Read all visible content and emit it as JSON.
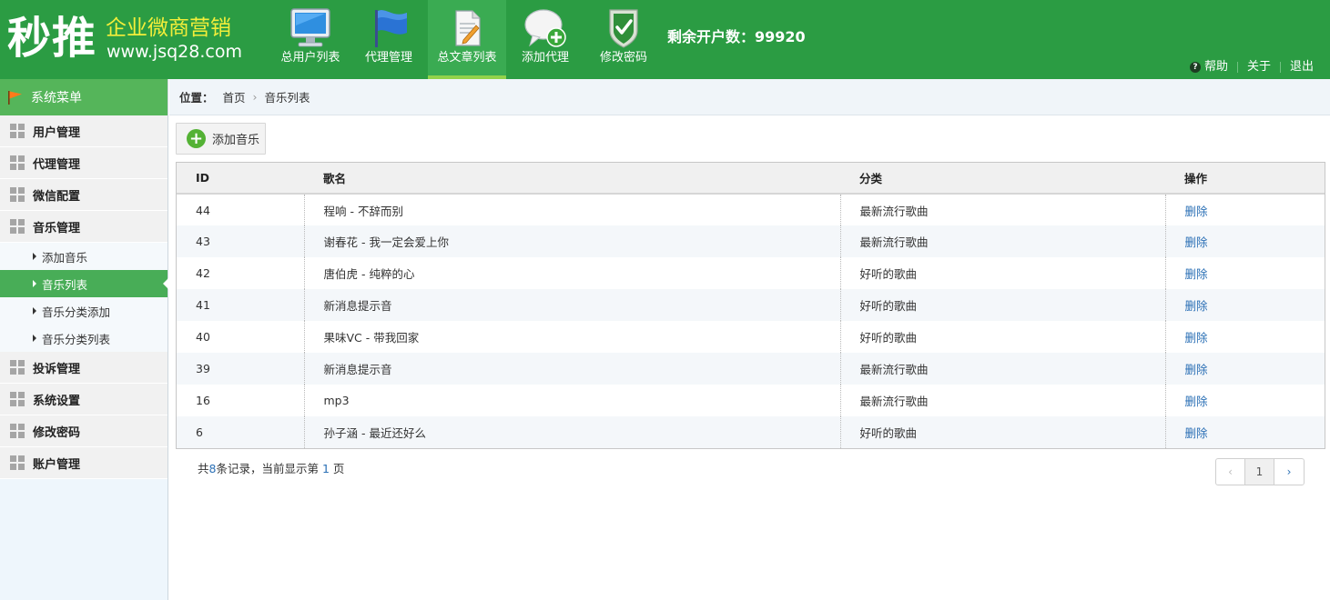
{
  "header": {
    "logo_main": "秒推",
    "logo_sub": "企业微商营销",
    "logo_url": "www.jsq28.com",
    "nav": [
      {
        "label": "总用户列表",
        "icon": "monitor-icon"
      },
      {
        "label": "代理管理",
        "icon": "flag-icon"
      },
      {
        "label": "总文章列表",
        "icon": "article-icon",
        "active": true
      },
      {
        "label": "添加代理",
        "icon": "chat-add-icon"
      },
      {
        "label": "修改密码",
        "icon": "shield-check-icon"
      }
    ],
    "remain_label": "剩余开户数：99920",
    "links": {
      "help": "帮助",
      "about": "关于",
      "logout": "退出"
    }
  },
  "sidebar": {
    "title": "系统菜单",
    "groups": [
      {
        "label": "用户管理"
      },
      {
        "label": "代理管理"
      },
      {
        "label": "微信配置"
      },
      {
        "label": "音乐管理",
        "items": [
          {
            "label": "添加音乐"
          },
          {
            "label": "音乐列表",
            "active": true
          },
          {
            "label": "音乐分类添加"
          },
          {
            "label": "音乐分类列表"
          }
        ]
      },
      {
        "label": "投诉管理"
      },
      {
        "label": "系统设置"
      },
      {
        "label": "修改密码"
      },
      {
        "label": "账户管理"
      }
    ]
  },
  "breadcrumb": {
    "pos_label": "位置：",
    "home": "首页",
    "current": "音乐列表"
  },
  "toolbar": {
    "add_label": "添加音乐"
  },
  "table": {
    "headers": [
      "ID",
      "歌名",
      "分类",
      "操作"
    ],
    "rows": [
      {
        "id": "44",
        "name": "程响 - 不辞而别",
        "category": "最新流行歌曲",
        "action": "删除"
      },
      {
        "id": "43",
        "name": "谢春花 - 我一定会爱上你",
        "category": "最新流行歌曲",
        "action": "删除"
      },
      {
        "id": "42",
        "name": "唐伯虎 - 纯粹的心",
        "category": "好听的歌曲",
        "action": "删除"
      },
      {
        "id": "41",
        "name": "新消息提示音",
        "category": "好听的歌曲",
        "action": "删除"
      },
      {
        "id": "40",
        "name": "果味VC - 带我回家",
        "category": "好听的歌曲",
        "action": "删除"
      },
      {
        "id": "39",
        "name": "新消息提示音",
        "category": "最新流行歌曲",
        "action": "删除"
      },
      {
        "id": "16",
        "name": "mp3",
        "category": "最新流行歌曲",
        "action": "删除"
      },
      {
        "id": "6",
        "name": "孙子涵 - 最近还好么",
        "category": "好听的歌曲",
        "action": "删除"
      }
    ]
  },
  "summary": {
    "prefix": "共",
    "total": "8",
    "middle": "条记录，当前显示第 ",
    "page": "1",
    "suffix": " 页"
  },
  "pager": {
    "prev": "‹",
    "current": "1",
    "next": "›"
  },
  "colors": {
    "header_green": "#2b9c43",
    "active_menu": "#48ad57",
    "link_blue": "#2a6fb5",
    "logo_yellow": "#f3ee3a"
  }
}
